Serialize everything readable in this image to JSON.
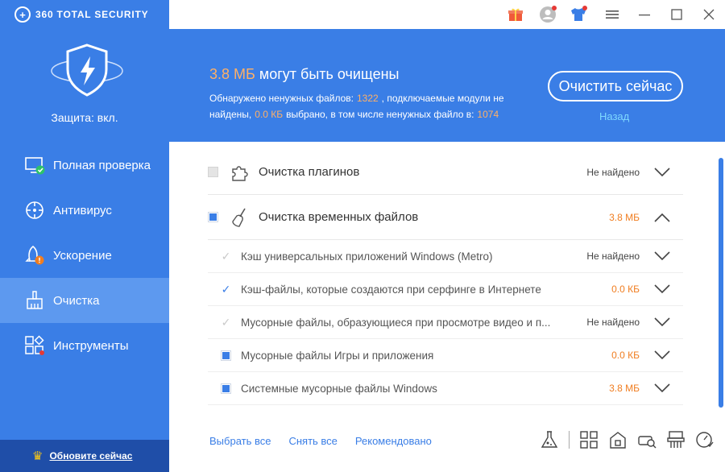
{
  "app": {
    "brand": "360 TOTAL SECURITY"
  },
  "sidebar": {
    "protection": "Защита: вкл.",
    "items": [
      {
        "label": "Полная проверка",
        "icon": "monitor-check-icon"
      },
      {
        "label": "Антивирус",
        "icon": "antivirus-icon"
      },
      {
        "label": "Ускорение",
        "icon": "rocket-icon"
      },
      {
        "label": "Очистка",
        "icon": "broom-icon",
        "active": true
      },
      {
        "label": "Инструменты",
        "icon": "tools-grid-icon"
      }
    ],
    "update": "Обновите сейчас"
  },
  "banner": {
    "size": "3.8 МБ",
    "title_rest": " могут быть очищены",
    "line1_a": "Обнаружено ненужных файлов:",
    "junk_count": "1322",
    "line1_b": ", подключаемые модули не найдены,",
    "selected_size": "0.0 КБ",
    "line1_c": "выбрано, в том числе ненужных файло в:",
    "selected_count": "1074",
    "clean_button": "Очистить сейчас",
    "back": "Назад"
  },
  "list": {
    "rows": [
      {
        "label": "Очистка плагинов",
        "status": "Не найдено"
      },
      {
        "label": "Очистка временных файлов",
        "status": "3.8 МБ"
      },
      {
        "label": "Кэш универсальных приложений Windows (Metro)",
        "status": "Не найдено"
      },
      {
        "label": "Кэш-файлы, которые создаются при серфинге в Интернете",
        "status": "0.0 КБ"
      },
      {
        "label": "Мусорные файлы, образующиеся при просмотре видео и п...",
        "status": "Не найдено"
      },
      {
        "label": "Мусорные файлы Игры и приложения",
        "status": "0.0 КБ"
      },
      {
        "label": "Системные мусорные файлы Windows",
        "status": "3.8 МБ"
      }
    ]
  },
  "footer": {
    "select_all": "Выбрать все",
    "deselect_all": "Снять все",
    "recommended": "Рекомендовано"
  },
  "colors": {
    "accent": "#3a7ee6",
    "orange": "#f07d20",
    "dark": "#1f4ea8"
  }
}
